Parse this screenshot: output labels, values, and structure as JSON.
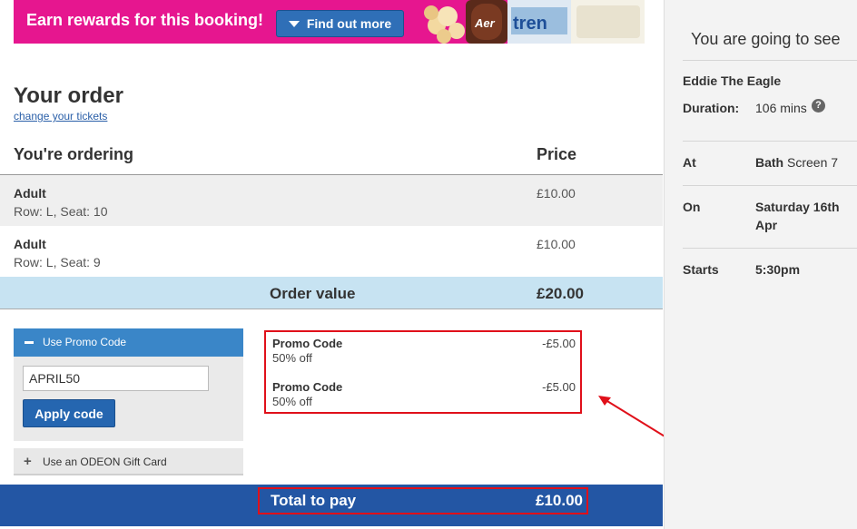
{
  "banner": {
    "text": "Earn rewards for this booking!",
    "button_label": "Find out more",
    "bg_color": "#e6168f",
    "button_icon": "triangle-down-icon"
  },
  "order": {
    "title": "Your order",
    "change_link": "change your tickets",
    "col_ordering": "You're ordering",
    "col_price": "Price",
    "tickets": [
      {
        "type": "Adult",
        "seat": "Row: L, Seat: 10",
        "price": "£10.00"
      },
      {
        "type": "Adult",
        "seat": "Row: L, Seat: 9",
        "price": "£10.00"
      }
    ],
    "order_value_label": "Order value",
    "order_value": "£20.00"
  },
  "promo_panel": {
    "tab_label": "Use Promo Code",
    "tab_icon": "minus-icon",
    "input_value": "APRIL50",
    "apply_label": "Apply code",
    "gift_label": "Use an ODEON Gift Card",
    "gift_icon": "plus-icon"
  },
  "promos": [
    {
      "name": "Promo Code",
      "desc": "50% off",
      "amount": "-£5.00"
    },
    {
      "name": "Promo Code",
      "desc": "50% off",
      "amount": "-£5.00"
    }
  ],
  "total": {
    "label": "Total to pay",
    "amount": "£10.00",
    "bar_color": "#2356a4"
  },
  "sidebar": {
    "title": "You are going to see",
    "film": "Eddie The Eagle",
    "duration_label": "Duration:",
    "duration_value": "106 mins",
    "help_icon": "question-icon",
    "at_label": "At",
    "at_cinema": "Bath",
    "at_screen": " Screen 7",
    "on_label": "On",
    "on_date_line1": "Saturday 16th",
    "on_date_line2": "Apr",
    "starts_label": "Starts",
    "starts_value": "5:30pm"
  },
  "colors": {
    "accent_blue": "#2566b0",
    "highlight_red": "#e0101a",
    "order_value_bg": "#c7e3f2"
  }
}
